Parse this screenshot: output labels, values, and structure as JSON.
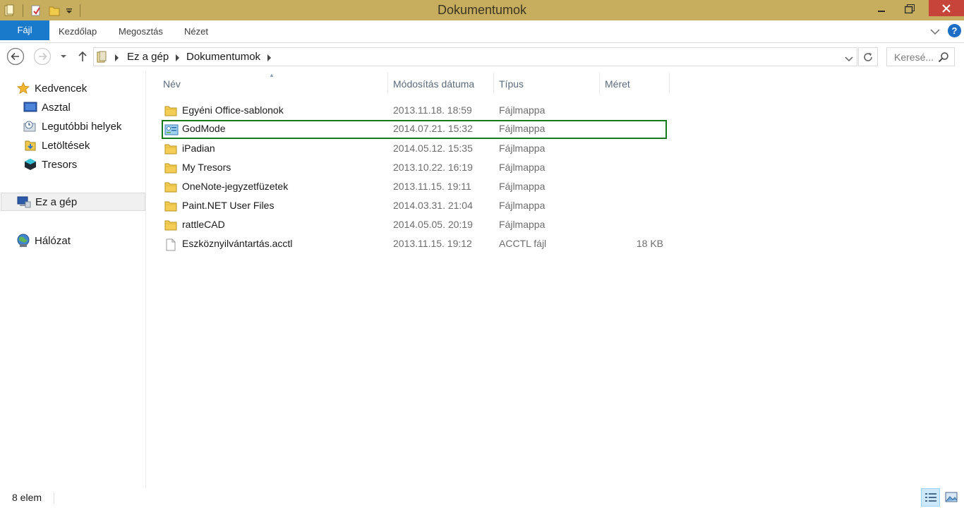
{
  "window": {
    "title": "Dokumentumok"
  },
  "ribbon": {
    "tabs": [
      "Fájl",
      "Kezdőlap",
      "Megosztás",
      "Nézet"
    ],
    "help": "?"
  },
  "address": {
    "crumbs": [
      "Ez a gép",
      "Dokumentumok"
    ]
  },
  "search": {
    "placeholder": "Keresé..."
  },
  "navpane": {
    "favorites_label": "Kedvencek",
    "favorites": [
      "Asztal",
      "Legutóbbi helyek",
      "Letöltések",
      "Tresors"
    ],
    "this_pc": "Ez a gép",
    "network": "Hálózat"
  },
  "columns": {
    "name": "Név",
    "date": "Módosítás dátuma",
    "type": "Típus",
    "size": "Méret"
  },
  "files": [
    {
      "name": "Egyéni Office-sablonok",
      "date": "2013.11.18. 18:59",
      "type": "Fájlmappa",
      "size": "",
      "icon": "folder-icon"
    },
    {
      "name": "GodMode",
      "date": "2014.07.21. 15:32",
      "type": "Fájlmappa",
      "size": "",
      "icon": "control-panel-icon"
    },
    {
      "name": "iPadian",
      "date": "2014.05.12. 15:35",
      "type": "Fájlmappa",
      "size": "",
      "icon": "folder-icon"
    },
    {
      "name": "My Tresors",
      "date": "2013.10.22. 16:19",
      "type": "Fájlmappa",
      "size": "",
      "icon": "folder-icon"
    },
    {
      "name": "OneNote-jegyzetfüzetek",
      "date": "2013.11.15. 19:11",
      "type": "Fájlmappa",
      "size": "",
      "icon": "folder-icon"
    },
    {
      "name": "Paint.NET User Files",
      "date": "2014.03.31. 21:04",
      "type": "Fájlmappa",
      "size": "",
      "icon": "folder-icon"
    },
    {
      "name": "rattleCAD",
      "date": "2014.05.05. 20:19",
      "type": "Fájlmappa",
      "size": "",
      "icon": "folder-icon"
    },
    {
      "name": "Eszköznyilvántartás.acctl",
      "date": "2013.11.15. 19:12",
      "type": "ACCTL fájl",
      "size": "18 KB",
      "icon": "file-icon"
    }
  ],
  "status": {
    "count": "8 elem"
  },
  "colors": {
    "titlebar": "#c7ae5e",
    "file_tab": "#1979ca",
    "close_button": "#c7443a",
    "highlight_border": "#187a1d"
  }
}
